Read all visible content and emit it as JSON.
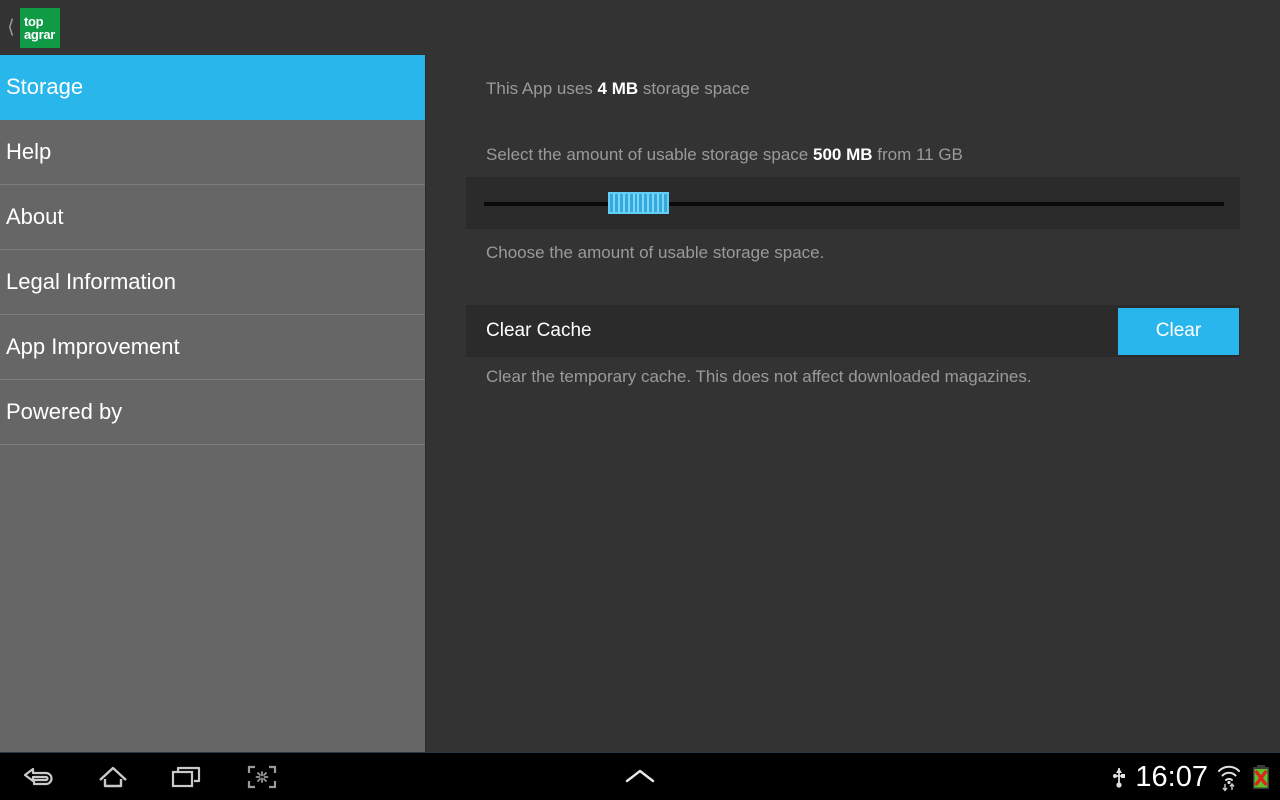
{
  "actionbar": {
    "back_icon": "back-chevron-icon",
    "logo_line1": "top",
    "logo_line2": "agrar",
    "logo_color": "#0f9a46"
  },
  "sidebar": {
    "selected_color": "#29b6ea",
    "items": [
      {
        "label": "Storage",
        "selected": true
      },
      {
        "label": "Help",
        "selected": false
      },
      {
        "label": "About",
        "selected": false
      },
      {
        "label": "Legal Information",
        "selected": false
      },
      {
        "label": "App Improvement",
        "selected": false
      },
      {
        "label": "Powered by",
        "selected": false
      }
    ]
  },
  "main": {
    "usage": {
      "prefix": "This App uses ",
      "value": "4 MB",
      "suffix": " storage space"
    },
    "select": {
      "prefix": "Select the amount of usable storage space ",
      "value": "500 MB",
      "suffix": " from 11 GB"
    },
    "slider": {
      "value_label": "500 MB",
      "max_label": "11 GB",
      "percent": 19
    },
    "slider_hint": "Choose the amount of usable storage space.",
    "clear_cache": {
      "label": "Clear Cache",
      "button_label": "Clear",
      "button_color": "#29b6ec",
      "hint": "Clear the temporary cache. This does not affect downloaded magazines."
    }
  },
  "navbar": {
    "back_icon": "back-arrow-icon",
    "home_icon": "home-icon",
    "recents_icon": "recent-apps-icon",
    "screenshot_icon": "screenshot-capture-icon",
    "handle_icon": "chevron-up-icon",
    "usb_icon": "usb-icon",
    "clock": "16:07",
    "wifi_icon": "wifi-icon",
    "battery_icon": "battery-error-icon"
  }
}
